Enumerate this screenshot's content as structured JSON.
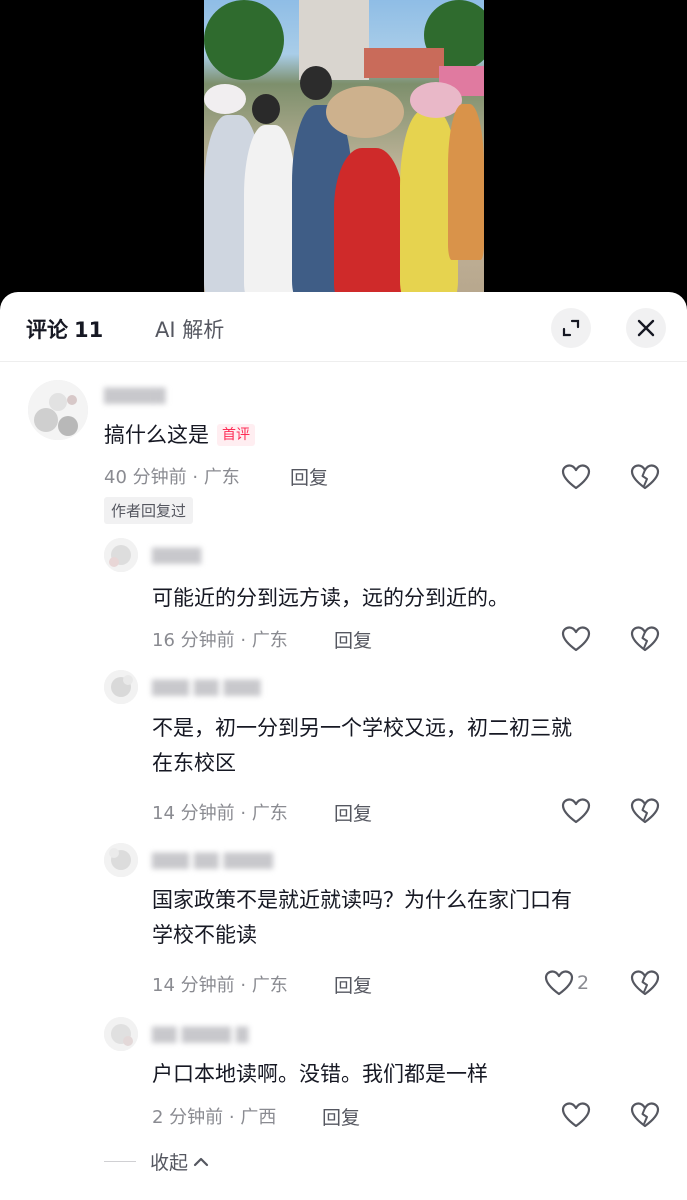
{
  "header": {
    "tab_comments": "评论",
    "comment_count": "11",
    "tab_ai": "AI 解析"
  },
  "comments": [
    {
      "text": "搞什么这是",
      "badge": "首评",
      "time": "40 分钟前",
      "location": "广东",
      "reply_label": "回复",
      "author_tag": "作者回复过",
      "likes": ""
    }
  ],
  "replies": [
    {
      "line1": "可能近的分到远方读，远的分到近的。",
      "line2": "",
      "time": "16 分钟前",
      "location": "广东",
      "reply_label": "回复",
      "likes": ""
    },
    {
      "line1": "不是，初一分到另一个学校又远，初二初三就",
      "line2": "在东校区",
      "time": "14 分钟前",
      "location": "广东",
      "reply_label": "回复",
      "likes": ""
    },
    {
      "line1": "国家政策不是就近就读吗？为什么在家门口有",
      "line2": "学校不能读",
      "time": "14 分钟前",
      "location": "广东",
      "reply_label": "回复",
      "likes": "2"
    },
    {
      "line1": "户口本地读啊。没错。我们都是一样",
      "line2": "",
      "time": "2 分钟前",
      "location": "广西",
      "reply_label": "回复",
      "likes": ""
    }
  ],
  "collapse_label": "收起",
  "icons": {
    "expand": "expand-icon",
    "close": "close-icon",
    "like": "heart-outline-icon",
    "dislike": "broken-heart-icon",
    "collapse": "chevron-up-icon"
  },
  "colors": {
    "badge_text": "#fe2c55",
    "badge_bg": "#ffeef1",
    "primary_text": "#161823",
    "secondary_text": "#8a8b91"
  }
}
